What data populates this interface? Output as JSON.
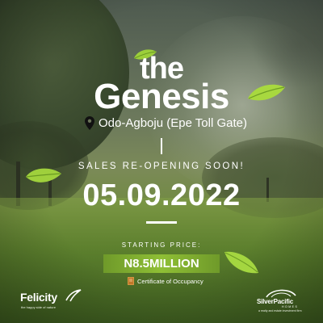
{
  "title_line1": "the",
  "title_line2": "Genesis",
  "location": "Odo-Agboju (Epe Toll Gate)",
  "sales_status": "SALES RE-OPENING SOON!",
  "date": "05.09.2022",
  "starting_price_label": "STARTING PRICE:",
  "price": "N8.5MILLION",
  "document_type": "Certificate of Occupancy",
  "logos": {
    "left_brand": "Felicity",
    "left_tagline": "the happy side of nature",
    "right_brand": "SilverPacific",
    "right_sub": "HOMES",
    "right_tagline": "a realty and estate investment firm"
  },
  "colors": {
    "accent_green": "#8fbf35",
    "text": "#ffffff"
  },
  "icons": [
    "leaf-icon",
    "map-pin-icon",
    "certificate-icon"
  ]
}
